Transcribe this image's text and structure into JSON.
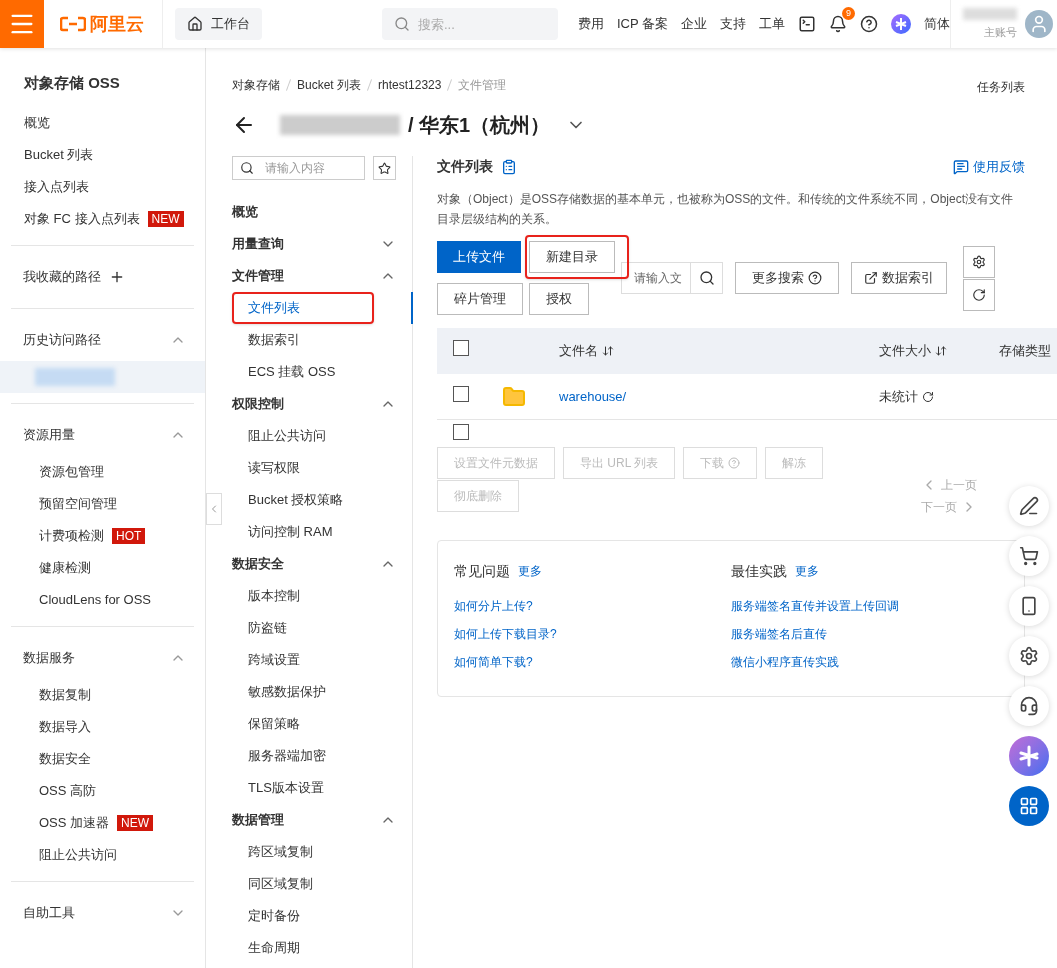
{
  "header": {
    "logo": "阿里云",
    "workbench": "工作台",
    "search_placeholder": "搜索...",
    "links": [
      "费用",
      "ICP 备案",
      "企业",
      "支持",
      "工单"
    ],
    "notification_count": "9",
    "language": "简体",
    "account_role": "主账号"
  },
  "sidebar": {
    "title": "对象存储 OSS",
    "items": [
      {
        "label": "概览"
      },
      {
        "label": "Bucket 列表"
      },
      {
        "label": "接入点列表"
      },
      {
        "label": "对象 FC 接入点列表",
        "badge": "NEW"
      }
    ],
    "sections": [
      {
        "title": "我收藏的路径",
        "kind": "add"
      },
      {
        "title": "历史访问路径",
        "kind": "group",
        "expanded": true,
        "items": [
          {
            "kind": "blurred",
            "selected": true
          }
        ]
      },
      {
        "title": "资源用量",
        "kind": "group",
        "expanded": true,
        "items": [
          {
            "label": "资源包管理",
            "selected": false
          },
          {
            "label": "预留空间管理",
            "selected": false
          },
          {
            "label": "计费项检测",
            "badge": "HOT",
            "selected": false
          },
          {
            "label": "健康检测",
            "selected": false
          },
          {
            "label": "CloudLens for OSS",
            "selected": false
          }
        ]
      },
      {
        "title": "数据服务",
        "kind": "group",
        "expanded": true,
        "items": [
          {
            "label": "数据复制",
            "selected": false
          },
          {
            "label": "数据导入",
            "selected": false
          },
          {
            "label": "数据安全",
            "selected": false
          },
          {
            "label": "OSS 高防",
            "selected": false
          },
          {
            "label": "OSS 加速器",
            "badge": "NEW",
            "selected": false
          },
          {
            "label": "阻止公共访问",
            "selected": false
          }
        ]
      },
      {
        "title": "自助工具",
        "kind": "group",
        "expanded": false
      }
    ]
  },
  "breadcrumb": [
    "对象存储",
    "Bucket 列表",
    "rhtest12323",
    "文件管理"
  ],
  "task_list": "任务列表",
  "bucket_title": {
    "region": "/ 华东1（杭州）"
  },
  "nav": {
    "search_placeholder": "请输入内容",
    "groups": [
      {
        "label": "概览",
        "kind": "link"
      },
      {
        "label": "用量查询",
        "kind": "group",
        "expanded": false
      },
      {
        "label": "文件管理",
        "kind": "group",
        "expanded": true,
        "children": [
          {
            "label": "文件列表",
            "selected": true,
            "highlighted": true
          },
          {
            "label": "数据索引",
            "selected": false,
            "highlighted": false
          },
          {
            "label": "ECS 挂载 OSS",
            "selected": false,
            "highlighted": false
          }
        ]
      },
      {
        "label": "权限控制",
        "kind": "group",
        "expanded": true,
        "children": [
          {
            "label": "阻止公共访问",
            "selected": false,
            "highlighted": false
          },
          {
            "label": "读写权限",
            "selected": false,
            "highlighted": false
          },
          {
            "label": "Bucket 授权策略",
            "selected": false,
            "highlighted": false
          },
          {
            "label": "访问控制 RAM",
            "selected": false,
            "highlighted": false
          }
        ]
      },
      {
        "label": "数据安全",
        "kind": "group",
        "expanded": true,
        "children": [
          {
            "label": "版本控制",
            "selected": false,
            "highlighted": false
          },
          {
            "label": "防盗链",
            "selected": false,
            "highlighted": false
          },
          {
            "label": "跨域设置",
            "selected": false,
            "highlighted": false
          },
          {
            "label": "敏感数据保护",
            "selected": false,
            "highlighted": false
          },
          {
            "label": "保留策略",
            "selected": false,
            "highlighted": false
          },
          {
            "label": "服务器端加密",
            "selected": false,
            "highlighted": false
          },
          {
            "label": "TLS版本设置",
            "selected": false,
            "highlighted": false
          }
        ]
      },
      {
        "label": "数据管理",
        "kind": "group",
        "expanded": true,
        "children": [
          {
            "label": "跨区域复制",
            "selected": false,
            "highlighted": false
          },
          {
            "label": "同区域复制",
            "selected": false,
            "highlighted": false
          },
          {
            "label": "定时备份",
            "selected": false,
            "highlighted": false
          },
          {
            "label": "生命周期",
            "selected": false,
            "highlighted": false
          }
        ]
      }
    ]
  },
  "main": {
    "title": "文件列表",
    "feedback": "使用反馈",
    "description": "对象（Object）是OSS存储数据的基本单元，也被称为OSS的文件。和传统的文件系统不同，Object没有文件目录层级结构的关系。",
    "buttons": [
      {
        "label": "上传文件",
        "kind": "primary",
        "highlighted": false
      },
      {
        "label": "新建目录",
        "kind": "default",
        "highlighted": true
      },
      {
        "label": "碎片管理",
        "kind": "default",
        "highlighted": false
      },
      {
        "label": "授权",
        "kind": "default",
        "highlighted": false
      }
    ],
    "search_placeholder": "请输入文",
    "more_search": "更多搜索",
    "data_index": "数据索引",
    "table": {
      "columns": [
        "文件名",
        "文件大小",
        "存储类型"
      ],
      "header_checked": false,
      "rows": [
        {
          "name": "warehouse/",
          "size": "未统计",
          "checked": false
        }
      ],
      "footer_checked": false
    },
    "batch_actions": [
      {
        "label": "设置文件元数据",
        "disabled": true,
        "help": false
      },
      {
        "label": "导出 URL 列表",
        "disabled": true,
        "help": false
      },
      {
        "label": "下载",
        "disabled": true,
        "help": true
      },
      {
        "label": "解冻",
        "disabled": true,
        "help": false
      },
      {
        "label": "彻底删除",
        "disabled": true,
        "help": false
      }
    ],
    "pagination": {
      "prev": "上一页",
      "next": "下一页",
      "disabled": true
    },
    "help_sections": [
      {
        "title": "常见问题",
        "more": "更多",
        "links": [
          "如何分片上传?",
          "如何上传下载目录?",
          "如何简单下载?"
        ]
      },
      {
        "title": "最佳实践",
        "more": "更多",
        "links": [
          "服务端签名直传并设置上传回调",
          "服务端签名后直传",
          "微信小程序直传实践"
        ]
      }
    ]
  }
}
